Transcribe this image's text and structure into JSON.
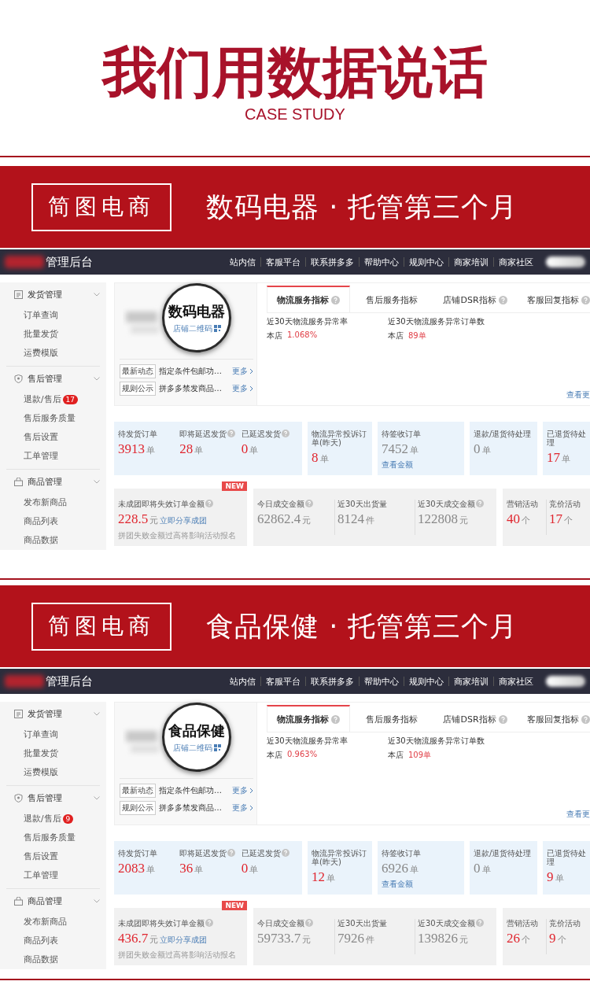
{
  "header": {
    "title": "我们用数据说话",
    "subtitle": "CASE STUDY"
  },
  "cases": [
    {
      "brand": "简图电商",
      "title": "数码电器 · 托管第三个月",
      "dashboard": {
        "console_title": "管理后台",
        "nav": [
          "站内信",
          "客服平台",
          "联系拼多多",
          "帮助中心",
          "规则中心",
          "商家培训",
          "商家社区"
        ],
        "sidebar": [
          {
            "label": "发货管理",
            "kind": "doc",
            "expanded": true,
            "items": [
              {
                "label": "订单查询"
              },
              {
                "label": "批量发货"
              },
              {
                "label": "运费模版"
              }
            ]
          },
          {
            "label": "售后管理",
            "kind": "shield",
            "expanded": true,
            "items": [
              {
                "label": "退款/售后",
                "badge": "17"
              },
              {
                "label": "售后服务质量"
              },
              {
                "label": "售后设置"
              },
              {
                "label": "工单管理"
              }
            ]
          },
          {
            "label": "商品管理",
            "kind": "bag",
            "expanded": true,
            "items": [
              {
                "label": "发布新商品"
              },
              {
                "label": "商品列表"
              },
              {
                "label": "商品数据"
              }
            ]
          }
        ],
        "magnifier_text": "数码电器",
        "qr_link": "店铺二维码",
        "news": [
          {
            "tag": "最新动态",
            "text": "指定条件包邮功…",
            "more": "更多"
          },
          {
            "tag": "规则公示",
            "text": "拼多多禁发商品…",
            "more": "更多"
          }
        ],
        "tabs": [
          {
            "label": "物流服务指标",
            "help": true,
            "selected": true
          },
          {
            "label": "售后服务指标",
            "help": false,
            "selected": false
          },
          {
            "label": "店铺DSR指标",
            "help": true,
            "selected": false
          },
          {
            "label": "客服回复指标",
            "help": true,
            "selected": false
          }
        ],
        "metrics": [
          {
            "label": "近30天物流服务异常率",
            "prefix": "本店",
            "value": "1.068%"
          },
          {
            "label": "近30天物流服务异常订单数",
            "prefix": "本店",
            "value": "89单"
          }
        ],
        "view_more": "查看更",
        "stat_groups": [
          {
            "cells": [
              {
                "label": "待发货订单",
                "help": false,
                "value": "3913",
                "unit": "单",
                "alert": true
              },
              {
                "label": "即将延迟发货",
                "help": true,
                "value": "28",
                "unit": "单",
                "alert": true
              },
              {
                "label": "已延迟发货",
                "help": true,
                "value": "0",
                "unit": "单",
                "alert": true
              }
            ]
          },
          {
            "cells": [
              {
                "label": "物流异常投诉订单(昨天)",
                "help": false,
                "value": "8",
                "unit": "单",
                "alert": true
              }
            ]
          },
          {
            "cells": [
              {
                "label": "待签收订单",
                "help": false,
                "value": "7452",
                "unit": "单",
                "alert": false,
                "link": "查看金额"
              }
            ]
          },
          {
            "cells": [
              {
                "label": "退款/退货待处理",
                "help": false,
                "value": "0",
                "unit": "单",
                "alert": false
              }
            ]
          },
          {
            "cells": [
              {
                "label": "已退货待处理",
                "help": false,
                "value": "17",
                "unit": "单",
                "alert": true
              }
            ]
          }
        ],
        "summary_groups": [
          {
            "badge": "NEW",
            "items": [
              {
                "label": "未成团即将失效订单金额",
                "help": true,
                "value": "228.5",
                "unit": "元",
                "alert": true,
                "link": "立即分享成团",
                "note": "拼团失败金额过高将影响活动报名"
              }
            ]
          },
          {
            "items": [
              {
                "label": "今日成交金额",
                "help": true,
                "value": "62862.4",
                "unit": "元",
                "alert": false
              },
              {
                "label": "近30天出货量",
                "help": false,
                "value": "8124",
                "unit": "件",
                "alert": false
              },
              {
                "label": "近30天成交金额",
                "help": true,
                "value": "122808",
                "unit": "元",
                "alert": false
              }
            ]
          },
          {
            "items": [
              {
                "label": "营销活动",
                "help": false,
                "value": "40",
                "unit": "个",
                "alert": true
              },
              {
                "label": "竞价活动",
                "help": false,
                "value": "17",
                "unit": "个",
                "alert": true
              }
            ]
          }
        ]
      }
    },
    {
      "brand": "简图电商",
      "title": "食品保健 · 托管第三个月",
      "dashboard": {
        "console_title": "管理后台",
        "nav": [
          "站内信",
          "客服平台",
          "联系拼多多",
          "帮助中心",
          "规则中心",
          "商家培训",
          "商家社区"
        ],
        "sidebar": [
          {
            "label": "发货管理",
            "kind": "doc",
            "expanded": true,
            "items": [
              {
                "label": "订单查询"
              },
              {
                "label": "批量发货"
              },
              {
                "label": "运费模版"
              }
            ]
          },
          {
            "label": "售后管理",
            "kind": "shield",
            "expanded": true,
            "items": [
              {
                "label": "退款/售后",
                "badge": "9"
              },
              {
                "label": "售后服务质量"
              },
              {
                "label": "售后设置"
              },
              {
                "label": "工单管理"
              }
            ]
          },
          {
            "label": "商品管理",
            "kind": "bag",
            "expanded": true,
            "items": [
              {
                "label": "发布新商品"
              },
              {
                "label": "商品列表"
              },
              {
                "label": "商品数据"
              }
            ]
          }
        ],
        "magnifier_text": "食品保健",
        "qr_link": "店铺二维码",
        "news": [
          {
            "tag": "最新动态",
            "text": "指定条件包邮功…",
            "more": "更多"
          },
          {
            "tag": "规则公示",
            "text": "拼多多禁发商品…",
            "more": "更多"
          }
        ],
        "tabs": [
          {
            "label": "物流服务指标",
            "help": true,
            "selected": true
          },
          {
            "label": "售后服务指标",
            "help": false,
            "selected": false
          },
          {
            "label": "店铺DSR指标",
            "help": true,
            "selected": false
          },
          {
            "label": "客服回复指标",
            "help": true,
            "selected": false
          }
        ],
        "metrics": [
          {
            "label": "近30天物流服务异常率",
            "prefix": "本店",
            "value": "0.963%"
          },
          {
            "label": "近30天物流服务异常订单数",
            "prefix": "本店",
            "value": "109单"
          }
        ],
        "view_more": "查看更",
        "stat_groups": [
          {
            "cells": [
              {
                "label": "待发货订单",
                "help": false,
                "value": "2083",
                "unit": "单",
                "alert": true
              },
              {
                "label": "即将延迟发货",
                "help": true,
                "value": "36",
                "unit": "单",
                "alert": true
              },
              {
                "label": "已延迟发货",
                "help": true,
                "value": "0",
                "unit": "单",
                "alert": true
              }
            ]
          },
          {
            "cells": [
              {
                "label": "物流异常投诉订单(昨天)",
                "help": false,
                "value": "12",
                "unit": "单",
                "alert": true
              }
            ]
          },
          {
            "cells": [
              {
                "label": "待签收订单",
                "help": false,
                "value": "6926",
                "unit": "单",
                "alert": false,
                "link": "查看金额"
              }
            ]
          },
          {
            "cells": [
              {
                "label": "退款/退货待处理",
                "help": false,
                "value": "0",
                "unit": "单",
                "alert": false
              }
            ]
          },
          {
            "cells": [
              {
                "label": "已退货待处理",
                "help": false,
                "value": "9",
                "unit": "单",
                "alert": true
              }
            ]
          }
        ],
        "summary_groups": [
          {
            "badge": "NEW",
            "items": [
              {
                "label": "未成团即将失效订单金额",
                "help": true,
                "value": "436.7",
                "unit": "元",
                "alert": true,
                "link": "立即分享成团",
                "note": "拼团失败金额过高将影响活动报名"
              }
            ]
          },
          {
            "items": [
              {
                "label": "今日成交金额",
                "help": true,
                "value": "59733.7",
                "unit": "元",
                "alert": false
              },
              {
                "label": "近30天出货量",
                "help": false,
                "value": "7926",
                "unit": "件",
                "alert": false
              },
              {
                "label": "近30天成交金额",
                "help": true,
                "value": "139826",
                "unit": "元",
                "alert": false
              }
            ]
          },
          {
            "items": [
              {
                "label": "营销活动",
                "help": false,
                "value": "26",
                "unit": "个",
                "alert": true
              },
              {
                "label": "竞价活动",
                "help": false,
                "value": "9",
                "unit": "个",
                "alert": true
              }
            ]
          }
        ]
      }
    }
  ]
}
